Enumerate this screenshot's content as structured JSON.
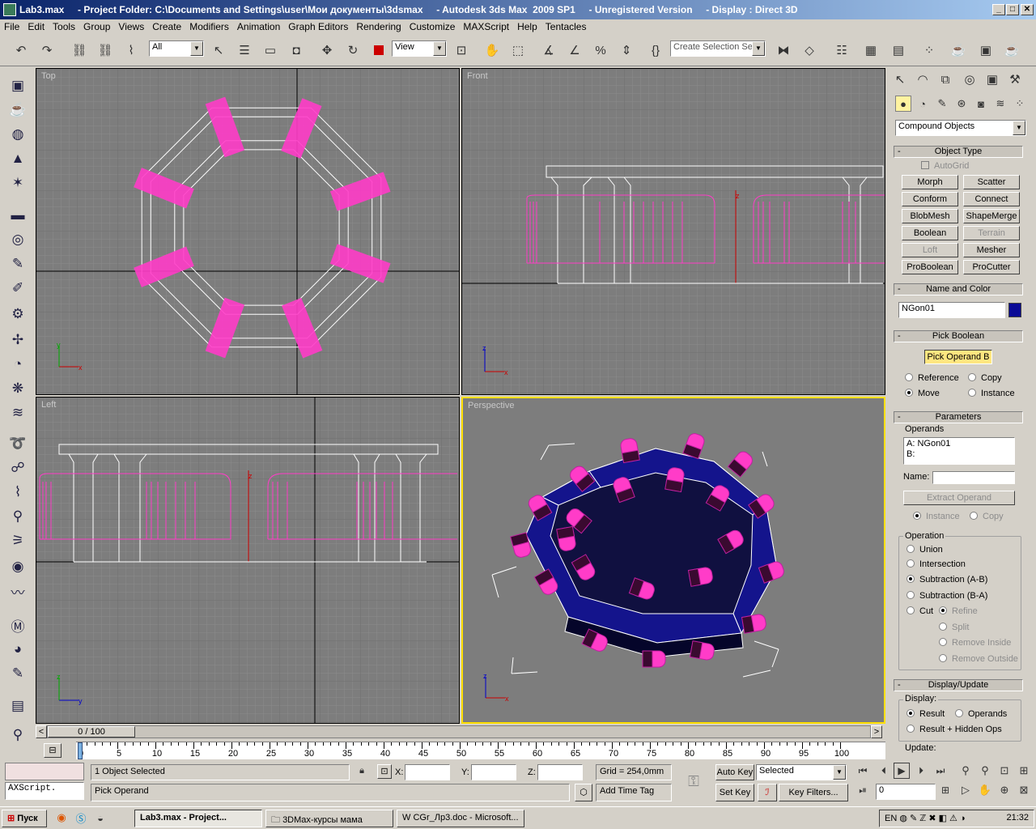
{
  "title": "Lab3.max     - Project Folder: C:\\Documents and Settings\\user\\Мои документы\\3dsmax     - Autodesk 3ds Max  2009 SP1     - Unregistered Version     - Display : Direct 3D",
  "menu": [
    "File",
    "Edit",
    "Tools",
    "Group",
    "Views",
    "Create",
    "Modifiers",
    "Animation",
    "Graph Editors",
    "Rendering",
    "Customize",
    "MAXScript",
    "Help",
    "Tentacles"
  ],
  "toolbar": {
    "filter": "All",
    "refcoord": "View",
    "selection_set": "Create Selection Set"
  },
  "viewports": {
    "top": "Top",
    "front": "Front",
    "left": "Left",
    "perspective": "Perspective"
  },
  "panel": {
    "category": "Compound Objects",
    "object_type": {
      "header": "Object Type",
      "autogrid": "AutoGrid",
      "buttons": [
        "Morph",
        "Scatter",
        "Conform",
        "Connect",
        "BlobMesh",
        "ShapeMerge",
        "Boolean",
        "Terrain",
        "Loft",
        "Mesher",
        "ProBoolean",
        "ProCutter"
      ]
    },
    "name_color": {
      "header": "Name and Color",
      "name": "NGon01",
      "color": "#0a0a96"
    },
    "pick_boolean": {
      "header": "Pick Boolean",
      "button": "Pick Operand B",
      "opts": [
        "Reference",
        "Copy",
        "Move",
        "Instance"
      ]
    },
    "parameters": {
      "header": "Parameters",
      "operands_label": "Operands",
      "operands": [
        "A: NGon01",
        "B:"
      ],
      "name_label": "Name:",
      "extract": "Extract Operand",
      "inst_opts": [
        "Instance",
        "Copy"
      ],
      "operation_label": "Operation",
      "ops": [
        "Union",
        "Intersection",
        "Subtraction (A-B)",
        "Subtraction (B-A)",
        "Cut"
      ],
      "cut_opts": [
        "Refine",
        "Split",
        "Remove Inside",
        "Remove Outside"
      ]
    },
    "display_update": {
      "header": "Display/Update",
      "display_label": "Display:",
      "opts": [
        "Result",
        "Operands",
        "Result + Hidden Ops"
      ],
      "update_label": "Update:"
    }
  },
  "timeline": {
    "frame": "0 / 100",
    "ticks": [
      "0",
      "5",
      "10",
      "15",
      "20",
      "25",
      "30",
      "35",
      "40",
      "45",
      "50",
      "55",
      "60",
      "65",
      "70",
      "75",
      "80",
      "85",
      "90",
      "95",
      "100"
    ]
  },
  "status": {
    "maxscript": "AXScript.",
    "selected": "1 Object Selected",
    "prompt": "Pick Operand",
    "x_label": "X:",
    "y_label": "Y:",
    "z_label": "Z:",
    "grid": "Grid = 254,0mm",
    "add_time_tag": "Add Time Tag",
    "auto_key": "Auto Key",
    "set_key": "Set Key",
    "key_mode": "Selected",
    "key_filters": "Key Filters...",
    "frame_field": "0"
  },
  "taskbar": {
    "start": "Пуск",
    "tasks": [
      "Lab3.max      - Project...",
      "3DMax-курсы мама",
      "CGr_Лр3.doc - Microsoft..."
    ],
    "lang": "EN",
    "clock": "21:32"
  },
  "colors": {
    "pink": "#ff3cc8",
    "blue": "#14148c",
    "viewport_bg": "#7d7d7d",
    "active_border": "#ffe000"
  }
}
